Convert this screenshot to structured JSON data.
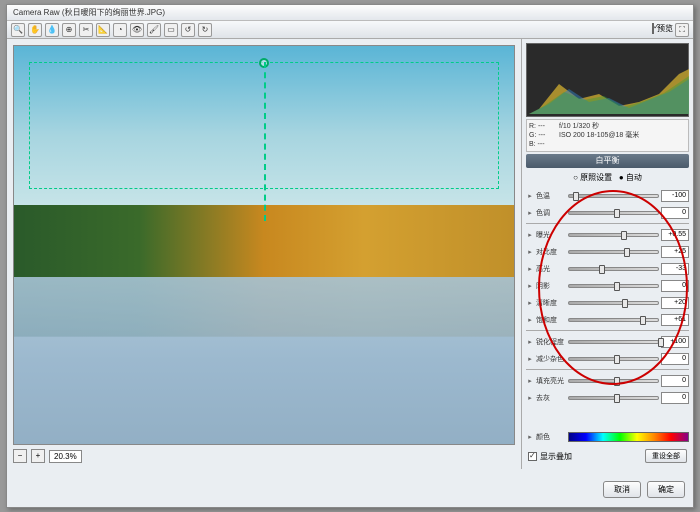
{
  "title": "Camera Raw (秋日暖阳下的绚丽世界.JPG)",
  "toolbar_preview": "预览",
  "info": {
    "r": "R: ---",
    "g": "G: ---",
    "b": "B: ---",
    "fstop": "f/10  1/320 秒",
    "iso": "ISO 200  18-105@18 毫米"
  },
  "panel_title": "白平衡",
  "radio1": "原照设置",
  "radio2": "自动",
  "sliders": [
    {
      "label": "色温",
      "value": "-100",
      "pos": 5
    },
    {
      "label": "色调",
      "value": "0",
      "pos": 50
    },
    {
      "label": "曝光",
      "value": "+0.55",
      "pos": 58
    },
    {
      "label": "对比度",
      "value": "+25",
      "pos": 62
    },
    {
      "label": "高光",
      "value": "-33",
      "pos": 34
    },
    {
      "label": "阴影",
      "value": "0",
      "pos": 50
    },
    {
      "label": "清晰度",
      "value": "+20",
      "pos": 60
    },
    {
      "label": "饱和度",
      "value": "+61",
      "pos": 80
    },
    {
      "label": "锐化程度",
      "value": "+100",
      "pos": 100
    },
    {
      "label": "减少杂色",
      "value": "0",
      "pos": 50
    },
    {
      "label": "填充亮光",
      "value": "0",
      "pos": 50
    },
    {
      "label": "去灰",
      "value": "0",
      "pos": 50
    }
  ],
  "color_label": "颜色",
  "show_overlay": "显示叠加",
  "reset_all": "重设全部",
  "zoom": "20.3%",
  "btn_cancel": "取消",
  "btn_ok": "确定"
}
